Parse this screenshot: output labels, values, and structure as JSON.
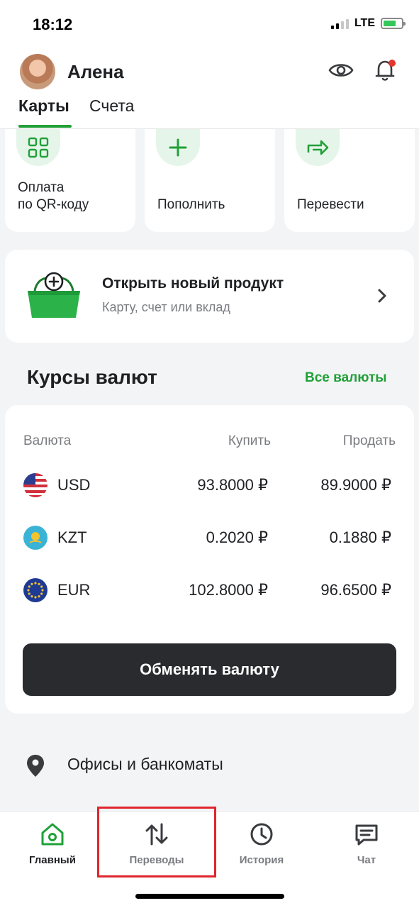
{
  "status": {
    "time": "18:12",
    "network": "LTE"
  },
  "header": {
    "user_name": "Алена",
    "tabs": [
      "Карты",
      "Счета"
    ],
    "active_tab": "Карты"
  },
  "quick_actions": [
    {
      "label": "Оплата\nпо QR-коду",
      "icon": "qr-code-icon"
    },
    {
      "label": "Пополнить",
      "icon": "plus-icon"
    },
    {
      "label": "Перевести",
      "icon": "transfer-arrow-icon"
    }
  ],
  "product": {
    "title": "Открыть новый продукт",
    "subtitle": "Карту, счет или вклад",
    "icon": "basket-plus-icon"
  },
  "rates": {
    "title": "Курсы валют",
    "all_link": "Все валюты",
    "headers": {
      "currency": "Валюта",
      "buy": "Купить",
      "sell": "Продать"
    },
    "rows": [
      {
        "code": "USD",
        "buy": "93.8000 ₽",
        "sell": "89.9000 ₽",
        "flag": "us-flag-icon"
      },
      {
        "code": "KZT",
        "buy": "0.2020 ₽",
        "sell": "0.1880 ₽",
        "flag": "kz-flag-icon"
      },
      {
        "code": "EUR",
        "buy": "102.8000 ₽",
        "sell": "96.6500 ₽",
        "flag": "eu-flag-icon"
      }
    ],
    "exchange_button": "Обменять валюту"
  },
  "offices": {
    "label": "Офисы и банкоматы",
    "icon": "location-pin-icon"
  },
  "tabbar": [
    {
      "label": "Главный",
      "icon": "home-icon",
      "active": true
    },
    {
      "label": "Переводы",
      "icon": "transfers-icon",
      "active": false
    },
    {
      "label": "История",
      "icon": "clock-icon",
      "active": false
    },
    {
      "label": "Чат",
      "icon": "chat-icon",
      "active": false
    }
  ],
  "colors": {
    "accent": "#21a038",
    "highlight": "#e0252d",
    "button_dark": "#2a2b2f"
  }
}
